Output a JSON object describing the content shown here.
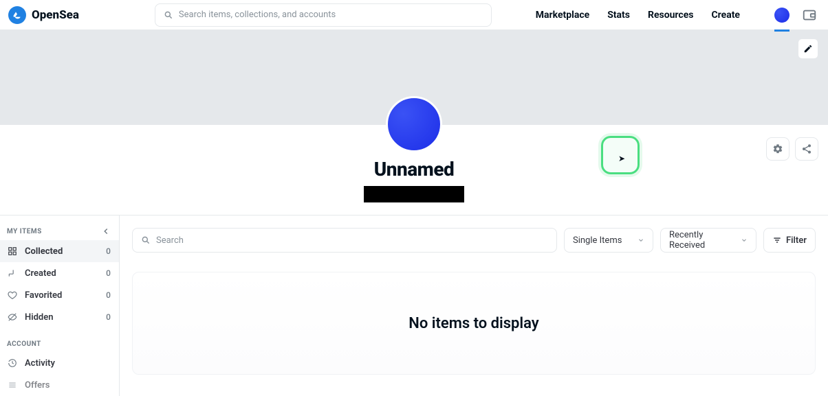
{
  "brand": {
    "name": "OpenSea"
  },
  "header": {
    "search_placeholder": "Search items, collections, and accounts",
    "nav": {
      "marketplace": "Marketplace",
      "stats": "Stats",
      "resources": "Resources",
      "create": "Create"
    }
  },
  "profile": {
    "name": "Unnamed"
  },
  "sidebar": {
    "section_my_items": "My Items",
    "section_account": "Account",
    "items": [
      {
        "label": "Collected",
        "count": "0"
      },
      {
        "label": "Created",
        "count": "0"
      },
      {
        "label": "Favorited",
        "count": "0"
      },
      {
        "label": "Hidden",
        "count": "0"
      }
    ],
    "account_items": [
      {
        "label": "Activity"
      },
      {
        "label": "Offers"
      }
    ]
  },
  "filters": {
    "search_placeholder": "Search",
    "view_select": "Single Items",
    "sort_select": "Recently Received",
    "filter_button": "Filter"
  },
  "main": {
    "empty_message": "No items to display"
  }
}
